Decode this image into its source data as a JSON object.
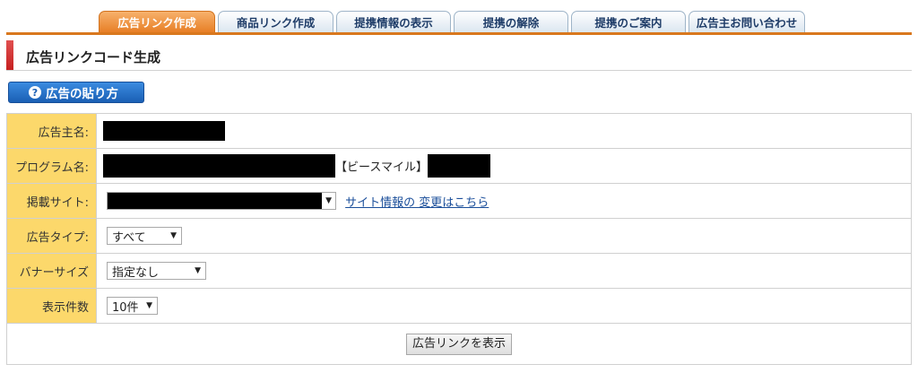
{
  "tabs": [
    {
      "label": "広告リンク作成",
      "active": true
    },
    {
      "label": "商品リンク作成",
      "active": false
    },
    {
      "label": "提携情報の表示",
      "active": false
    },
    {
      "label": "提携の解除",
      "active": false
    },
    {
      "label": "提携のご案内",
      "active": false
    },
    {
      "label": "広告主お問い合わせ",
      "active": false
    }
  ],
  "section": {
    "title": "広告リンクコード生成"
  },
  "howto_button": {
    "icon": "question-circle-icon",
    "label": "広告の貼り方"
  },
  "form": {
    "advertiser": {
      "label": "広告主名:"
    },
    "program": {
      "label": "プログラム名:",
      "visible_text": "【ビースマイル】"
    },
    "site": {
      "label": "掲載サイト:",
      "link": "サイト情報の 変更はこちら"
    },
    "ad_type": {
      "label": "広告タイプ:",
      "value": "すべて"
    },
    "banner_size": {
      "label": "バナーサイズ",
      "value": "指定なし"
    },
    "count": {
      "label": "表示件数",
      "value": "10件"
    },
    "submit": "広告リンクを表示"
  },
  "colors": {
    "accent": "#e77f26",
    "label_bg": "#fcd86b",
    "title_bar": "#c62020",
    "button_blue": "#1a5fb4"
  }
}
